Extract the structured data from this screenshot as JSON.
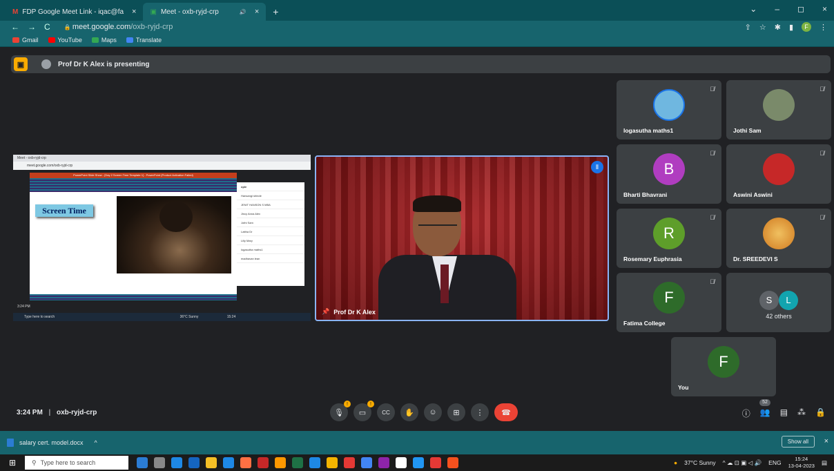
{
  "browser": {
    "tabs": [
      {
        "label": "FDP Google Meet Link - iqac@fa",
        "close": "×"
      },
      {
        "label": "Meet - oxb-ryjd-crp",
        "close": "×"
      }
    ],
    "new_tab": "+",
    "tab_extra_icons": "🔊",
    "window_controls": [
      "⌄",
      "–",
      "◻",
      "×"
    ],
    "nav": [
      "←",
      "→",
      "C"
    ],
    "url_host": "meet.google.com",
    "url_path": "/oxb-ryjd-crp",
    "profile_initial": "F",
    "bookmarks": [
      "Gmail",
      "YouTube",
      "Maps",
      "Translate"
    ]
  },
  "meet": {
    "presenting_banner": "Prof Dr K Alex is presenting",
    "shared_screen": {
      "chrome_tab": "Meet - oxb-ryjd-crp",
      "chrome_url": "meet.google.com/oxb-ryjd-crp",
      "ppt_title": "PowerPoint Slide Show - [Day 2 Screen Time Template 1] - PowerPoint (Product Activation Failed)",
      "slide_label": "Screen Time",
      "panel_title": "ople",
      "panel_names": [
        "Hansangi shinde",
        "JENIT HANSON S MBA",
        "Jincy Anna Alex",
        "Jothi Sam",
        "Lattha Dr",
        "Lilly Mary",
        "logasutha maths1",
        "madhavan lean"
      ],
      "mini_time": "3:24 PM",
      "mini_search": "Type here to search",
      "mini_weather": "36°C Sunny",
      "mini_clock": "15:24"
    },
    "main_video": {
      "name": "Prof Dr K Alex"
    },
    "participants": [
      {
        "name": "logasutha maths1",
        "initial": "",
        "color": "#6fb7e0",
        "muted": true
      },
      {
        "name": "Jothi Sam",
        "initial": "",
        "color": "#7a8a6a",
        "muted": true
      },
      {
        "name": "Bharti Bhavrani",
        "initial": "B",
        "color": "#b03dc0",
        "muted": true
      },
      {
        "name": "Aswini Aswini",
        "initial": "",
        "color": "#c62828",
        "muted": true
      },
      {
        "name": "Rosemary Euphrasia",
        "initial": "R",
        "color": "#5e9e2a",
        "muted": true
      },
      {
        "name": "Dr. SREEDEVI S",
        "initial": "",
        "color": "#e0a13a",
        "muted": true
      },
      {
        "name": "Fatima College",
        "initial": "F",
        "color": "#2e6b2a",
        "muted": true
      }
    ],
    "others": {
      "label": "42 others",
      "initials": [
        "S",
        "L"
      ],
      "colors": [
        "#5f6368",
        "#12a4af"
      ]
    },
    "you": {
      "name": "You",
      "initial": "F",
      "color": "#2e6b2a"
    },
    "time": "3:24 PM",
    "separator": "|",
    "meeting_code": "oxb-ryjd-crp",
    "people_count": "52",
    "controls": {
      "mic": "🎙",
      "cam": "▭",
      "cc": "CC",
      "hand": "✋",
      "emoji": "☺",
      "present": "⊞",
      "more": "⋮",
      "end": "☎"
    }
  },
  "downloads": {
    "file": "salary cert. model.docx",
    "chevron": "^",
    "show_all": "Show all",
    "close": "×"
  },
  "taskbar": {
    "search_placeholder": "Type here to search",
    "weather": "37°C Sunny",
    "lang": "ENG",
    "time": "15:24",
    "date": "13-04-2023",
    "app_colors": [
      "#2b7cd3",
      "#888",
      "#1e88e5",
      "#1565c0",
      "#f6c026",
      "#1e88e5",
      "#ff7043",
      "#c62828",
      "#ff9800",
      "#1e7145",
      "#1e88e5",
      "#f4b400",
      "#e53935",
      "#4285f4",
      "#8e24aa",
      "#ffffff",
      "#2196f3",
      "#e53935",
      "#f4511e"
    ]
  }
}
